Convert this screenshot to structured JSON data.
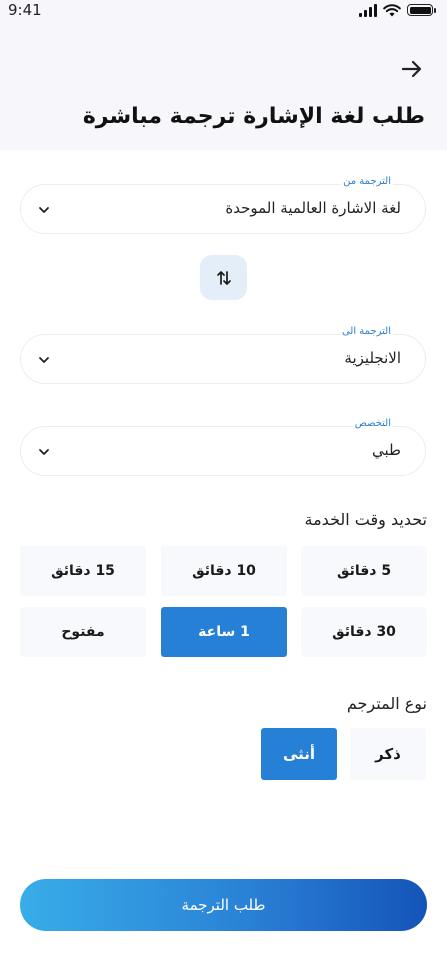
{
  "status_bar": {
    "time": "9:41"
  },
  "header": {
    "title": "طلب لغة الإشارة ترجمة مباشرة"
  },
  "from_field": {
    "label": "الترجمة من",
    "value": "لغة الاشارة العالمية الموحدة"
  },
  "to_field": {
    "label": "الترجمة الى",
    "value": "الانجليزية"
  },
  "specialty_field": {
    "label": "التخصص",
    "value": "طبي"
  },
  "service_time": {
    "title": "تحديد وقت الخدمة",
    "options": [
      {
        "label": "5 دقائق",
        "selected": false
      },
      {
        "label": "10 دقائق",
        "selected": false
      },
      {
        "label": "15 دقائق",
        "selected": false
      },
      {
        "label": "30 دقائق",
        "selected": false
      },
      {
        "label": "1 ساعة",
        "selected": true
      },
      {
        "label": "مفتوح",
        "selected": false
      }
    ]
  },
  "translator_type": {
    "title": "نوع المترجم",
    "options": [
      {
        "label": "ذكر",
        "selected": false
      },
      {
        "label": "أنثى",
        "selected": true
      }
    ]
  },
  "submit": {
    "label": "طلب الترجمة"
  },
  "colors": {
    "accent": "#2680d6",
    "label": "#2a7fd4",
    "gradient_start": "#38ade8",
    "gradient_end": "#1454b8"
  },
  "icons": {
    "back": "arrow-right-icon",
    "swap": "swap-vertical-icon",
    "dropdown": "chevron-down-icon"
  }
}
